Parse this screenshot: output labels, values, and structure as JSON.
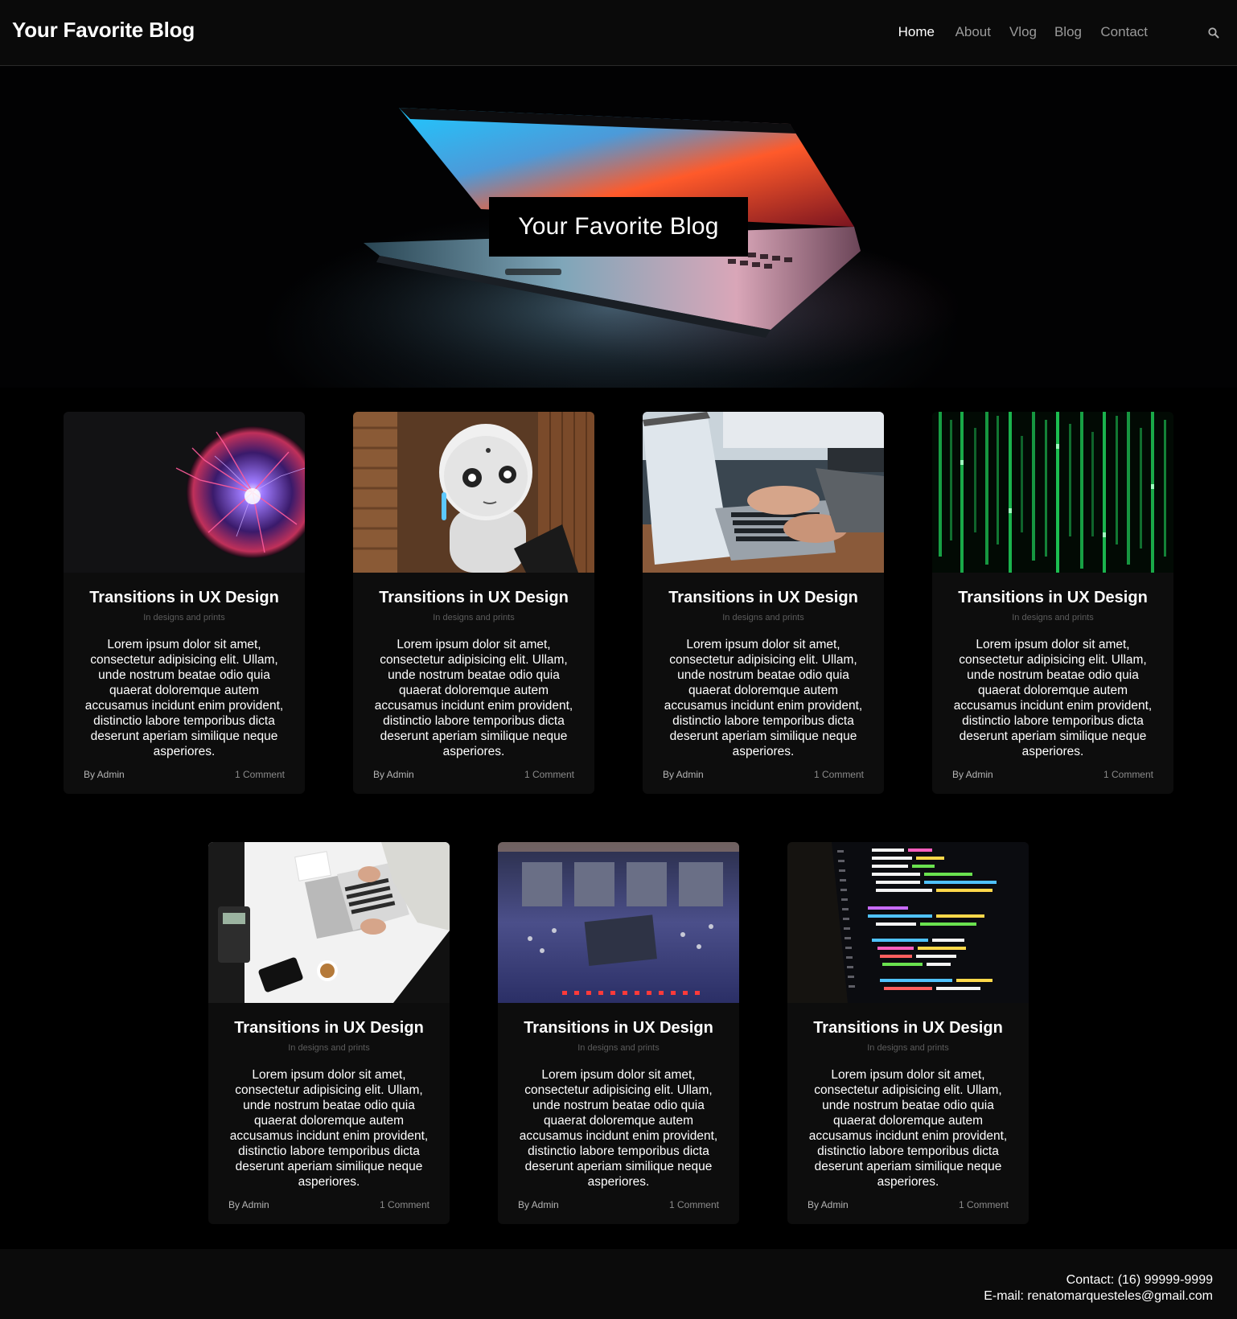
{
  "header": {
    "brand": "Your Favorite Blog",
    "nav": [
      {
        "label": "Home",
        "active": true
      },
      {
        "label": "About",
        "active": false
      },
      {
        "label": "Vlog",
        "active": false
      },
      {
        "label": "Blog",
        "active": false
      },
      {
        "label": "Contact",
        "active": false
      }
    ],
    "search_icon": "search-icon"
  },
  "hero": {
    "title": "Your Favorite Blog",
    "image": "laptop-opening-glow"
  },
  "posts": [
    {
      "image": "plasma-ball",
      "title": "Transitions in UX Design",
      "subtitle": "In designs and prints",
      "body": "Lorem ipsum dolor sit amet, consectetur adipisicing elit. Ullam, unde nostrum beatae odio quia quaerat doloremque autem accusamus incidunt enim provident, distinctio labore temporibus dicta deserunt aperiam similique neque asperiores.",
      "author": "By Admin",
      "comments": "1 Comment"
    },
    {
      "image": "robot",
      "title": "Transitions in UX Design",
      "subtitle": "In designs and prints",
      "body": "Lorem ipsum dolor sit amet, consectetur adipisicing elit. Ullam, unde nostrum beatae odio quia quaerat doloremque autem accusamus incidunt enim provident, distinctio labore temporibus dicta deserunt aperiam similique neque asperiores.",
      "author": "By Admin",
      "comments": "1 Comment"
    },
    {
      "image": "typing-laptop",
      "title": "Transitions in UX Design",
      "subtitle": "In designs and prints",
      "body": "Lorem ipsum dolor sit amet, consectetur adipisicing elit. Ullam, unde nostrum beatae odio quia quaerat doloremque autem accusamus incidunt enim provident, distinctio labore temporibus dicta deserunt aperiam similique neque asperiores.",
      "author": "By Admin",
      "comments": "1 Comment"
    },
    {
      "image": "matrix-code",
      "title": "Transitions in UX Design",
      "subtitle": "In designs and prints",
      "body": "Lorem ipsum dolor sit amet, consectetur adipisicing elit. Ullam, unde nostrum beatae odio quia quaerat doloremque autem accusamus incidunt enim provident, distinctio labore temporibus dicta deserunt aperiam similique neque asperiores.",
      "author": "By Admin",
      "comments": "1 Comment"
    },
    {
      "image": "desk-laptop-topdown",
      "title": "Transitions in UX Design",
      "subtitle": "In designs and prints",
      "body": "Lorem ipsum dolor sit amet, consectetur adipisicing elit. Ullam, unde nostrum beatae odio quia quaerat doloremque autem accusamus incidunt enim provident, distinctio labore temporibus dicta deserunt aperiam similique neque asperiores.",
      "author": "By Admin",
      "comments": "1 Comment"
    },
    {
      "image": "circuit-board",
      "title": "Transitions in UX Design",
      "subtitle": "In designs and prints",
      "body": "Lorem ipsum dolor sit amet, consectetur adipisicing elit. Ullam, unde nostrum beatae odio quia quaerat doloremque autem accusamus incidunt enim provident, distinctio labore temporibus dicta deserunt aperiam similique neque asperiores.",
      "author": "By Admin",
      "comments": "1 Comment"
    },
    {
      "image": "code-screen",
      "title": "Transitions in UX Design",
      "subtitle": "In designs and prints",
      "body": "Lorem ipsum dolor sit amet, consectetur adipisicing elit. Ullam, unde nostrum beatae odio quia quaerat doloremque autem accusamus incidunt enim provident, distinctio labore temporibus dicta deserunt aperiam similique neque asperiores.",
      "author": "By Admin",
      "comments": "1 Comment"
    }
  ],
  "footer": {
    "contact": "Contact: (16) 99999-9999",
    "email": "E-mail: renatomarquesteles@gmail.com"
  },
  "colors": {
    "background": "#000000",
    "header_bg": "#0a0a0a",
    "card_bg": "#0d0d0d",
    "nav_inactive": "#9a9a9a",
    "nav_active": "#ffffff"
  }
}
